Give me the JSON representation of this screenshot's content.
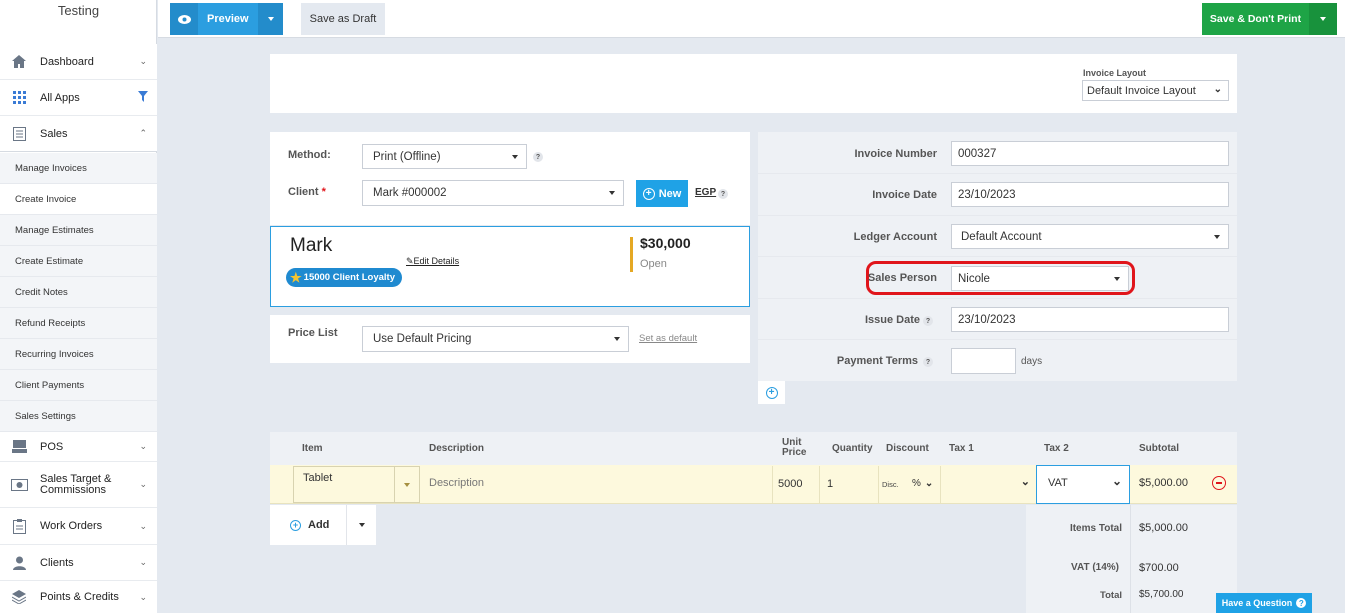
{
  "app": {
    "brand": "Testing"
  },
  "sidebar": {
    "items": [
      {
        "label": "Dashboard",
        "icon": "home-icon"
      },
      {
        "label": "All Apps",
        "icon": "grid-icon"
      },
      {
        "label": "Sales",
        "icon": "sales-icon"
      }
    ],
    "sub_items": [
      "Manage Invoices",
      "Create Invoice",
      "Manage Estimates",
      "Create Estimate",
      "Credit Notes",
      "Refund Receipts",
      "Recurring Invoices",
      "Client Payments",
      "Sales Settings"
    ],
    "bottom_items": [
      {
        "label": "POS",
        "icon": "pos-icon"
      },
      {
        "label": "Sales Target &",
        "label2": "Commissions",
        "icon": "commissions-icon"
      },
      {
        "label": "Work Orders",
        "icon": "work-orders-icon"
      },
      {
        "label": "Clients",
        "icon": "clients-icon"
      },
      {
        "label": "Points & Credits",
        "icon": "points-icon"
      }
    ]
  },
  "toolbar": {
    "preview": "Preview",
    "save_draft": "Save as Draft",
    "save_dont_print": "Save & Don't Print"
  },
  "layout_section": {
    "label": "Invoice Layout",
    "value": "Default Invoice Layout"
  },
  "client_section": {
    "method_label": "Method:",
    "method_value": "Print (Offline)",
    "client_label": "Client",
    "required_mark": "*",
    "client_value": "Mark #000002",
    "new_button": "New",
    "currency": "EGP"
  },
  "client_card": {
    "name": "Mark",
    "edit_details": "Edit Details",
    "loyalty": "15000 Client Loyalty",
    "balance": "$30,000",
    "status": "Open"
  },
  "price_list": {
    "label": "Price List",
    "value": "Use Default Pricing",
    "set_default": "Set as default"
  },
  "invoice_info": {
    "number_label": "Invoice Number",
    "number_value": "000327",
    "date_label": "Invoice Date",
    "date_value": "23/10/2023",
    "ledger_label": "Ledger Account",
    "ledger_value": "Default Account",
    "sales_person_label": "Sales Person",
    "sales_person_value": "Nicole",
    "issue_label": "Issue Date",
    "issue_value": "23/10/2023",
    "terms_label": "Payment Terms",
    "terms_value": "",
    "terms_unit": "days"
  },
  "items_table": {
    "headers": {
      "item": "Item",
      "description": "Description",
      "unit_price_1": "Unit",
      "unit_price_2": "Price",
      "quantity": "Quantity",
      "discount": "Discount",
      "tax1": "Tax 1",
      "tax2": "Tax 2",
      "subtotal": "Subtotal"
    },
    "row": {
      "item": "Tablet",
      "description_placeholder": "Description",
      "unit_price": "5000",
      "quantity": "1",
      "disc": "Disc.",
      "disc_type": "%",
      "tax1": "",
      "tax2": "VAT",
      "subtotal": "$5,000.00"
    },
    "add_label": "Add"
  },
  "totals": {
    "items_total_label": "Items Total",
    "items_total": "$5,000.00",
    "vat_label": "VAT (14%)",
    "vat": "$700.00",
    "total_label": "Total",
    "total": "$5,700.00"
  },
  "help": {
    "label": "Have a Question"
  },
  "colors": {
    "primary": "#2b9ee0",
    "success": "#1ea446",
    "highlight": "#e0151b",
    "row_bg": "#fdf9dd"
  }
}
